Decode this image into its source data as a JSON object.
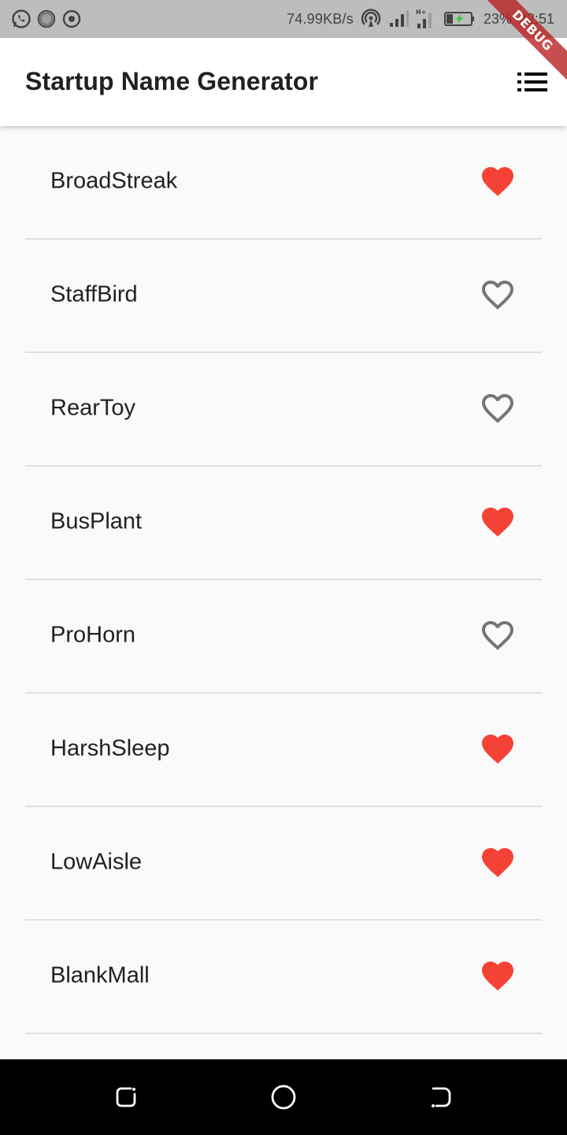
{
  "status_bar": {
    "net_speed": "74.99KB/s",
    "battery": "23%",
    "time": "22:51",
    "icons_left": [
      "whatsapp-icon",
      "app-icon",
      "target-icon"
    ],
    "icons_right": [
      "hotspot-icon",
      "signal-icon",
      "data-icon",
      "battery-charging-icon"
    ]
  },
  "debug_banner": "DEBUG",
  "app_bar": {
    "title": "Startup Name Generator",
    "action_icon": "list-icon"
  },
  "items": [
    {
      "name": "BroadStreak",
      "saved": true
    },
    {
      "name": "StaffBird",
      "saved": false
    },
    {
      "name": "RearToy",
      "saved": false
    },
    {
      "name": "BusPlant",
      "saved": true
    },
    {
      "name": "ProHorn",
      "saved": false
    },
    {
      "name": "HarshSleep",
      "saved": true
    },
    {
      "name": "LowAisle",
      "saved": true
    },
    {
      "name": "BlankMall",
      "saved": true
    }
  ],
  "colors": {
    "saved_heart": "#f44336",
    "unsaved_heart": "#757575",
    "app_bar": "#ffffff",
    "status_bar": "#bdbdbd",
    "background": "#fafafa",
    "nav_bar": "#000000"
  },
  "nav_bar": {
    "buttons": [
      "recent-apps-icon",
      "home-icon",
      "back-icon"
    ]
  }
}
